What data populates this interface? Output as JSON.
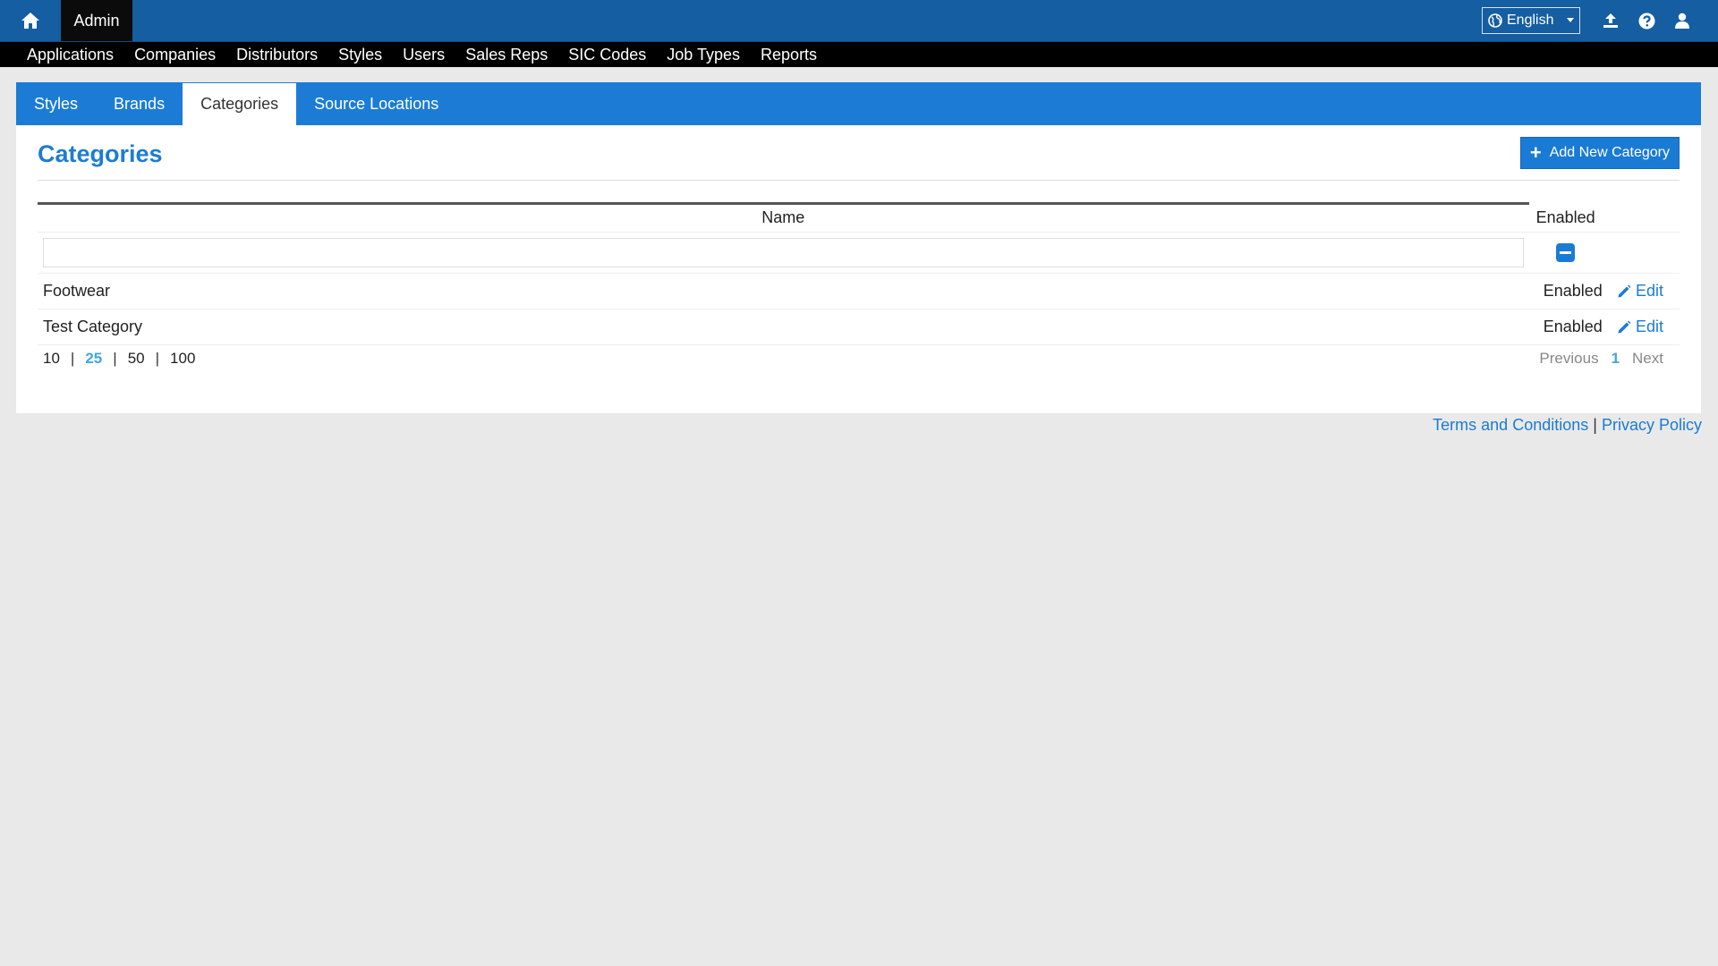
{
  "topbar": {
    "admin_label": "Admin",
    "language": "English",
    "icons": [
      "home-icon",
      "globe-icon",
      "upload-icon",
      "help-icon",
      "user-icon"
    ]
  },
  "nav": {
    "items": [
      "Applications",
      "Companies",
      "Distributors",
      "Styles",
      "Users",
      "Sales Reps",
      "SIC Codes",
      "Job Types",
      "Reports"
    ]
  },
  "subtabs": {
    "items": [
      "Styles",
      "Brands",
      "Categories",
      "Source Locations"
    ],
    "active": "Categories"
  },
  "page": {
    "title": "Categories",
    "add_button": "Add New Category"
  },
  "table": {
    "headers": {
      "name": "Name",
      "enabled": "Enabled"
    },
    "rows": [
      {
        "name": "Footwear",
        "status": "Enabled",
        "action": "Edit"
      },
      {
        "name": "Test Category",
        "status": "Enabled",
        "action": "Edit"
      }
    ]
  },
  "pager": {
    "sizes": [
      "10",
      "25",
      "50",
      "100"
    ],
    "active_size": "25",
    "separator": "|",
    "previous": "Previous",
    "current_page": "1",
    "next": "Next"
  },
  "footer": {
    "terms": "Terms and Conditions",
    "separator": "|",
    "privacy": "Privacy Policy"
  },
  "colors": {
    "topbar": "#145ea1",
    "accent": "#1c7cd5",
    "nav_bg": "#000000",
    "page_bg": "#e9e9e9"
  }
}
